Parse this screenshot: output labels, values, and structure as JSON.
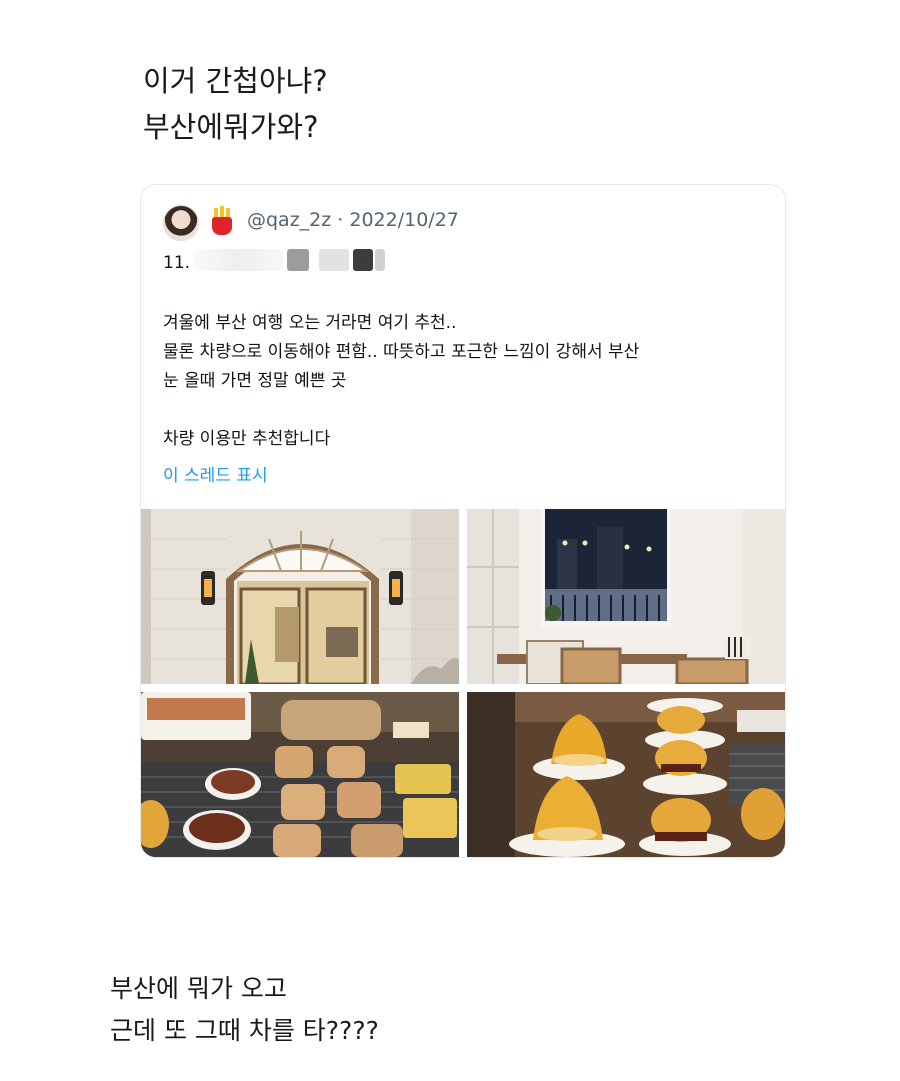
{
  "caption_top": {
    "line1": "이거 간첩아냐?",
    "line2": "부산에뭐가와?"
  },
  "tweet": {
    "handle": "@qaz_2z · 2022/10/27",
    "number": "11.",
    "lines": [
      "겨울에 부산 여행 오는 거라면 여기 추천..",
      "물론 차량으로 이동해야 편함.. 따뜻하고 포근한 느낌이 강해서 부산",
      "눈 올때 가면 정말 예쁜 곳",
      "",
      "차량 이용만 추천합니다"
    ],
    "thread_link": "이 스레드 표시",
    "link_color": "#1d9bf0",
    "photos": [
      "cafe-entrance-photo",
      "cafe-interior-window-photo",
      "pastry-display-photo",
      "pastry-stack-photo"
    ]
  },
  "caption_bottom": {
    "line1": "부산에 뭐가 오고",
    "line2": "근데 또 그때 차를 타????"
  }
}
